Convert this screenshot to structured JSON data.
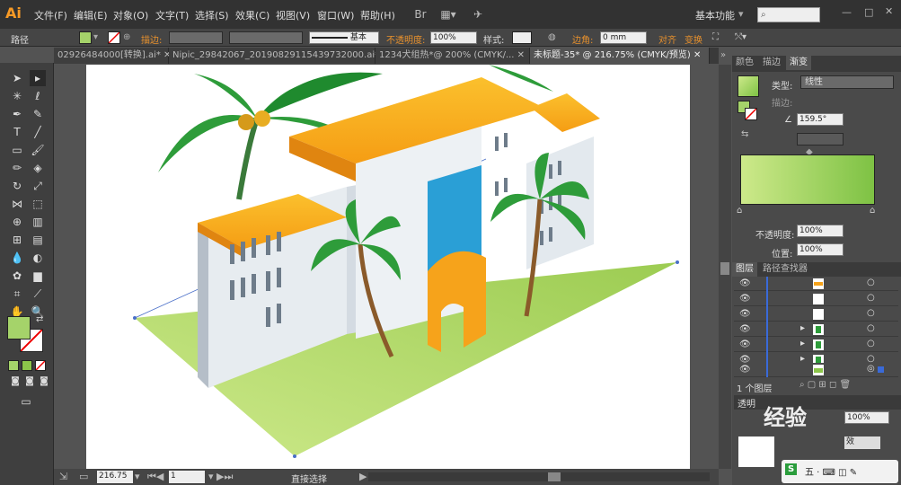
{
  "app": {
    "logo": "Ai"
  },
  "menubar": {
    "items": [
      "文件(F)",
      "编辑(E)",
      "对象(O)",
      "文字(T)",
      "选择(S)",
      "效果(C)",
      "视图(V)",
      "窗口(W)",
      "帮助(H)"
    ],
    "workspace": "基本功能",
    "search_placeholder": ""
  },
  "control": {
    "mode_label": "路径",
    "stroke_label": "描边:",
    "stroke_style": "基本",
    "opacity_label": "不透明度:",
    "opacity_value": "100%",
    "style_label": "样式:",
    "corner_label": "边角:",
    "corner_value": "0 mm",
    "align_label": "对齐",
    "transform_label": "变换"
  },
  "tabs": [
    {
      "label": "02926484000[转换].ai*",
      "active": false
    },
    {
      "label": "Nipic_29842067_20190829115439732000.ai*",
      "active": false
    },
    {
      "label": "1234犬组热*@ 200% (CMYK/...",
      "active": false
    },
    {
      "label": "未标题-35* @ 216.75% (CMYK/预览)",
      "active": true
    }
  ],
  "gradient_panel": {
    "tabs": [
      "颜色",
      "描边",
      "渐变"
    ],
    "type_label": "类型:",
    "type_value": "线性",
    "stroke_label": "描边:",
    "angle_value": "159.5°",
    "opacity_label": "不透明度:",
    "opacity_value": "100%",
    "position_label": "位置:",
    "position_value": "100%",
    "start_color": "#cde98a",
    "end_color": "#7ec244"
  },
  "layers_panel": {
    "tabs": [
      "图层",
      "路径查找器"
    ],
    "count_label": "1 个图层"
  },
  "transparency": {
    "tab": "透明",
    "opacity_value": "100%",
    "mode_value": "效"
  },
  "status": {
    "zoom": "216.75",
    "page": "1",
    "tool": "直接选择"
  },
  "watermark": {
    "text": "经验"
  },
  "colors": {
    "accent": "#f79a26",
    "ground": "#b9d96e",
    "roof": "#f6a31b",
    "blue": "#2a9fd6"
  }
}
